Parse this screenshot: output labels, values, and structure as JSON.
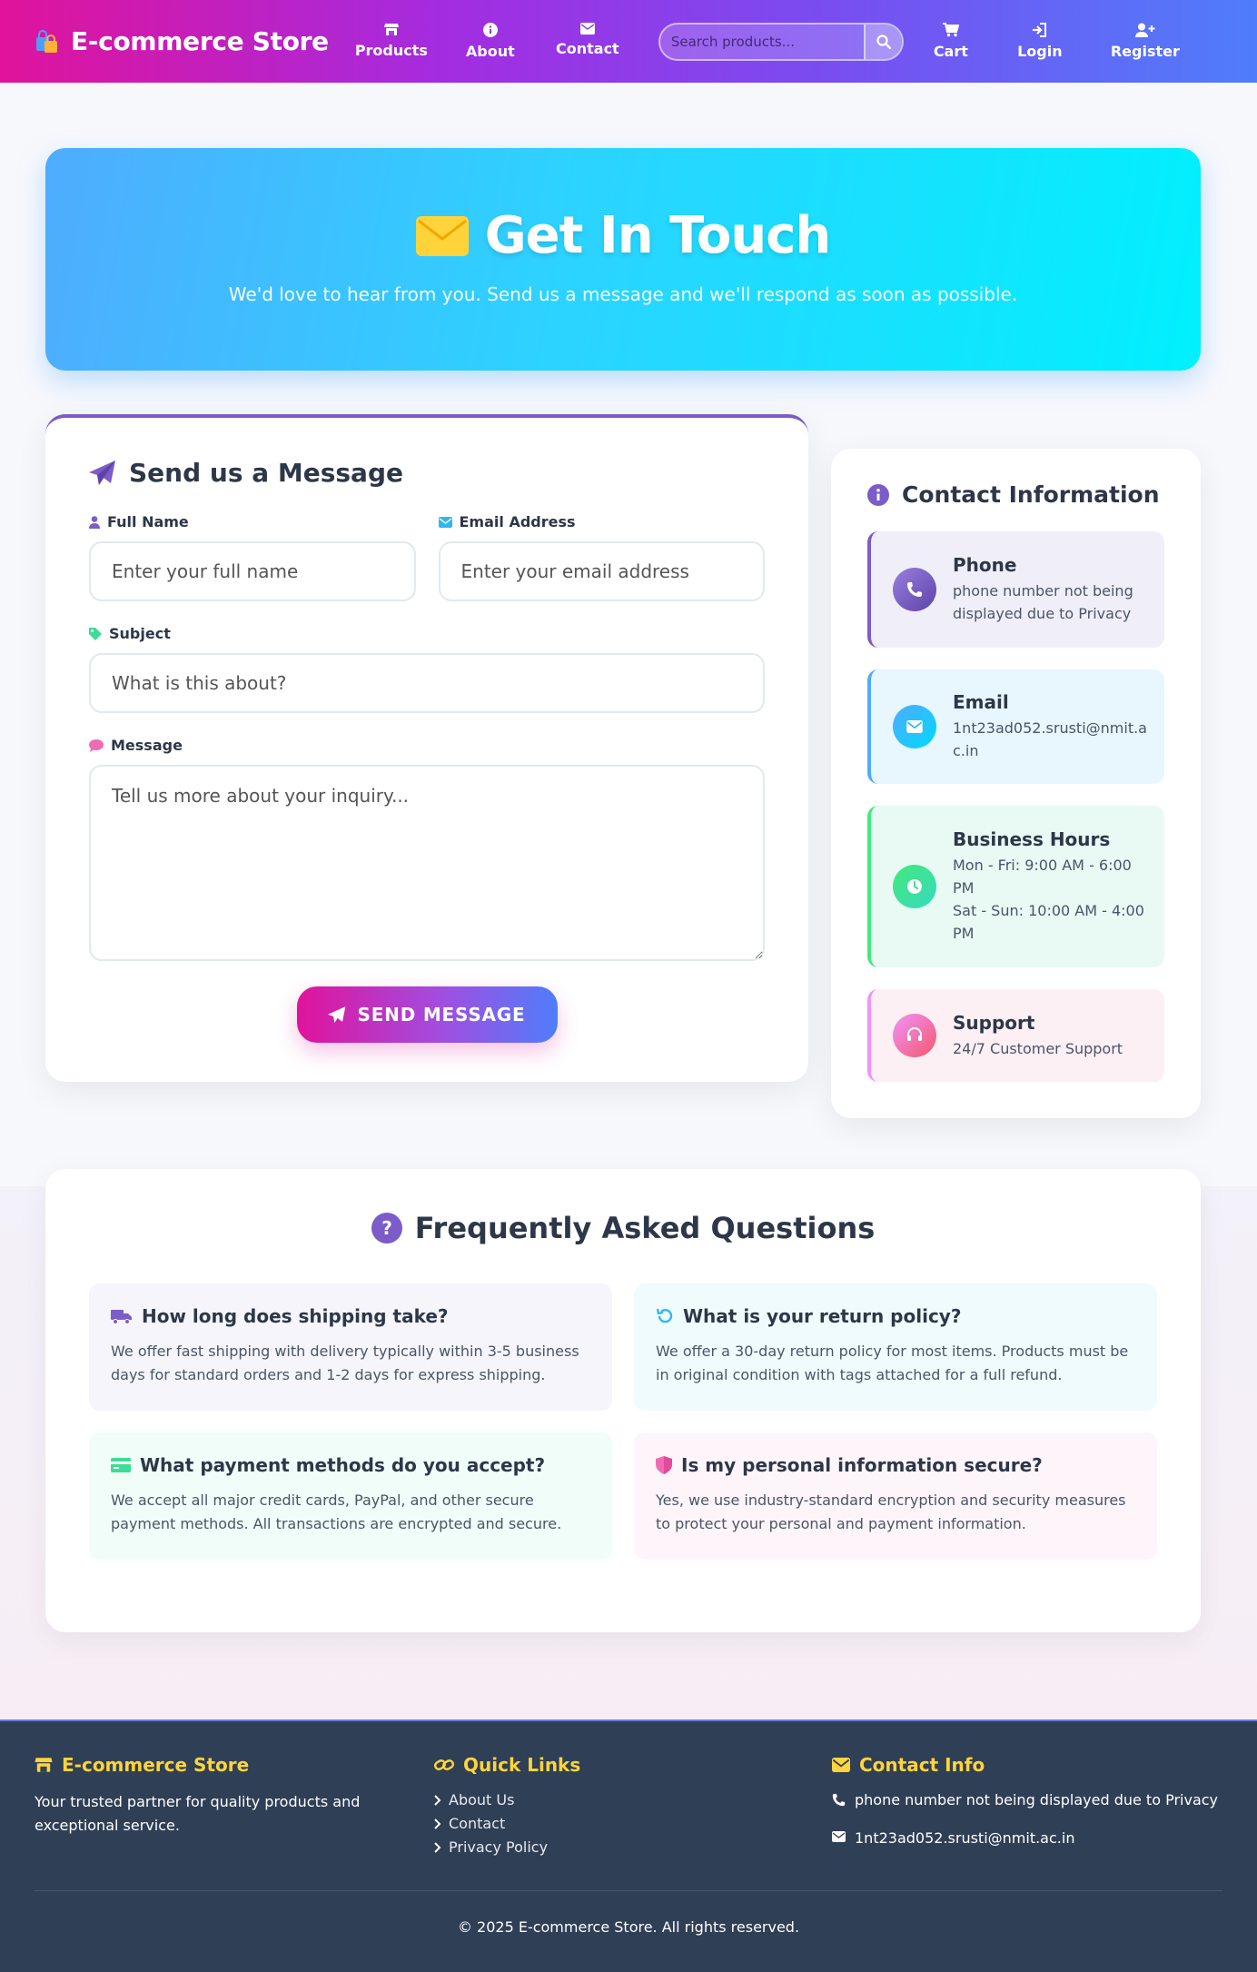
{
  "nav": {
    "brand": "E-commerce Store",
    "links": {
      "products": "Products",
      "about": "About",
      "contact": "Contact"
    },
    "search_placeholder": "Search products...",
    "cart": "Cart",
    "login": "Login",
    "register": "Register"
  },
  "hero": {
    "title": "Get In Touch",
    "subtitle": "We'd love to hear from you. Send us a message and we'll respond as soon as possible."
  },
  "form": {
    "title": "Send us a Message",
    "name_label": "Full Name",
    "name_placeholder": "Enter your full name",
    "email_label": "Email Address",
    "email_placeholder": "Enter your email address",
    "subject_label": "Subject",
    "subject_placeholder": "What is this about?",
    "message_label": "Message",
    "message_placeholder": "Tell us more about your inquiry...",
    "submit": "SEND MESSAGE"
  },
  "contact_info": {
    "title": "Contact Information",
    "items": [
      {
        "title": "Phone",
        "lines": [
          "phone number not being",
          "displayed due to Privacy"
        ]
      },
      {
        "title": "Email",
        "lines": [
          "1nt23ad052.srusti@nmit.a",
          "c.in"
        ]
      },
      {
        "title": "Business Hours",
        "lines": [
          "Mon - Fri: 9:00 AM - 6:00",
          "PM",
          "Sat - Sun: 10:00 AM - 4:00",
          "PM"
        ]
      },
      {
        "title": "Support",
        "lines": [
          "24/7 Customer Support"
        ]
      }
    ]
  },
  "faq": {
    "title": "Frequently Asked Questions",
    "items": [
      {
        "q": "How long does shipping take?",
        "a": "We offer fast shipping with delivery typically within 3-5 business days for standard orders and 1-2 days for express shipping."
      },
      {
        "q": "What is your return policy?",
        "a": "We offer a 30-day return policy for most items. Products must be in original condition with tags attached for a full refund."
      },
      {
        "q": "What payment methods do you accept?",
        "a": "We accept all major credit cards, PayPal, and other secure payment methods. All transactions are encrypted and secure."
      },
      {
        "q": "Is my personal information secure?",
        "a": "Yes, we use industry-standard encryption and security measures to protect your personal and payment information."
      }
    ]
  },
  "footer": {
    "brand": "E-commerce Store",
    "tagline": "Your trusted partner for quality products and exceptional service.",
    "quick_links_title": "Quick Links",
    "links": [
      "About Us",
      "Contact",
      "Privacy Policy"
    ],
    "contact_title": "Contact Info",
    "phone": "phone number not being displayed due to Privacy",
    "email": "1nt23ad052.srusti@nmit.ac.in",
    "copyright": "© 2025 E-commerce Store. All rights reserved."
  },
  "colors": {
    "brand_pink": "#e0139b",
    "brand_blue": "#4f7dfb",
    "accent_purple": "#7b5cc8",
    "hero_cyan": "#00f0fe",
    "footer_bg": "#2f3f55",
    "footer_accent": "#ffd43b"
  },
  "icons": {
    "brand": "shopping-bags-icon",
    "products": "store-icon",
    "about": "info-icon",
    "contact": "envelope-icon",
    "search": "search-icon",
    "cart": "cart-icon",
    "login": "login-icon",
    "register": "user-plus-icon"
  }
}
